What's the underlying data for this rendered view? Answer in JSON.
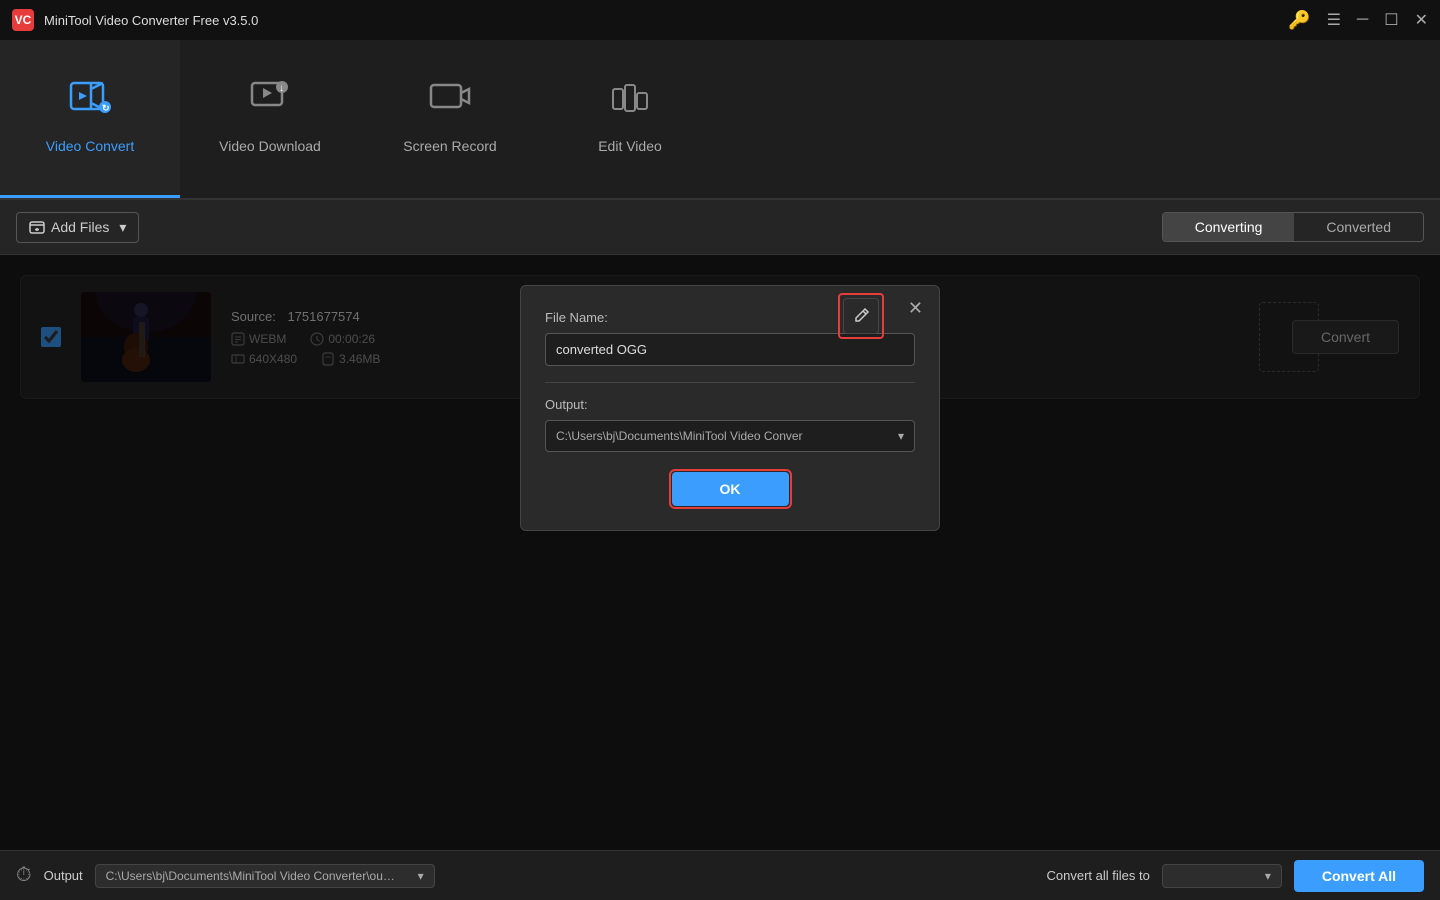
{
  "app": {
    "title": "MiniTool Video Converter Free v3.5.0",
    "logo": "VC"
  },
  "titlebar": {
    "controls": [
      "⚿",
      "≡",
      "─",
      "□",
      "✕"
    ]
  },
  "nav": {
    "tabs": [
      {
        "id": "video-convert",
        "label": "Video Convert",
        "icon": "▶",
        "active": true
      },
      {
        "id": "video-download",
        "label": "Video Download",
        "icon": "⬇",
        "active": false
      },
      {
        "id": "screen-record",
        "label": "Screen Record",
        "icon": "📹",
        "active": false
      },
      {
        "id": "edit-video",
        "label": "Edit Video",
        "icon": "✂",
        "active": false
      }
    ]
  },
  "toolbar": {
    "add_files_label": "Add Files",
    "converting_label": "Converting",
    "converted_label": "Converted"
  },
  "file_card": {
    "source_label": "Source:",
    "source_value": "1751677574",
    "format": "WEBM",
    "duration": "00:00:26",
    "resolution": "640X480",
    "size": "3.46MB",
    "convert_btn": "Convert"
  },
  "modal": {
    "close_icon": "✕",
    "file_name_label": "File Name:",
    "file_name_value": "converted OGG",
    "output_label": "Output:",
    "output_path": "C:\\Users\\bj\\Documents\\MiniTool Video Conver",
    "ok_label": "OK",
    "edit_icon": "✎"
  },
  "bottom_bar": {
    "output_label": "Output",
    "output_path": "C:\\Users\\bj\\Documents\\MiniTool Video Converter\\output",
    "convert_all_label": "Convert all files to",
    "convert_all_btn": "Convert All"
  }
}
